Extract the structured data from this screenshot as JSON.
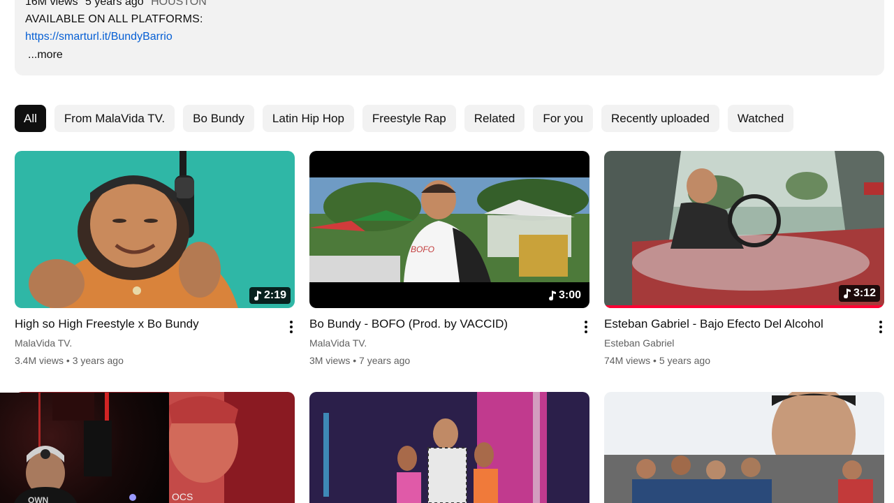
{
  "description": {
    "views": "16M views",
    "age": "5 years ago",
    "location": "HOUSTON",
    "line": "AVAILABLE ON ALL PLATFORMS:",
    "link": "https://smarturl.it/BundyBarrio",
    "more": "...more"
  },
  "chips": [
    {
      "label": "All",
      "active": true
    },
    {
      "label": "From MalaVida TV."
    },
    {
      "label": "Bo Bundy"
    },
    {
      "label": "Latin Hip Hop"
    },
    {
      "label": "Freestyle Rap"
    },
    {
      "label": "Related"
    },
    {
      "label": "For you"
    },
    {
      "label": "Recently uploaded"
    },
    {
      "label": "Watched"
    }
  ],
  "videos": [
    {
      "title": "High so High Freestyle x Bo Bundy",
      "channel": "MalaVida TV.",
      "views": "3.4M views",
      "age": "3 years ago",
      "duration": "2:19"
    },
    {
      "title": "Bo Bundy - BOFO (Prod. by VACCID)",
      "channel": "MalaVida TV.",
      "views": "3M views",
      "age": "7 years ago",
      "duration": "3:00"
    },
    {
      "title": "Esteban Gabriel - Bajo Efecto Del Alcohol",
      "channel": "Esteban Gabriel",
      "views": "74M views",
      "age": "5 years ago",
      "duration": "3:12",
      "watched_fraction": 1.0
    }
  ],
  "icons": {
    "duration": "music-note-icon",
    "menu": "more-vert-icon"
  },
  "colors": {
    "link": "#065fd4",
    "progress": "#ff0033",
    "chip_active": "#0f0f0f",
    "chip_bg": "#f2f2f2"
  }
}
